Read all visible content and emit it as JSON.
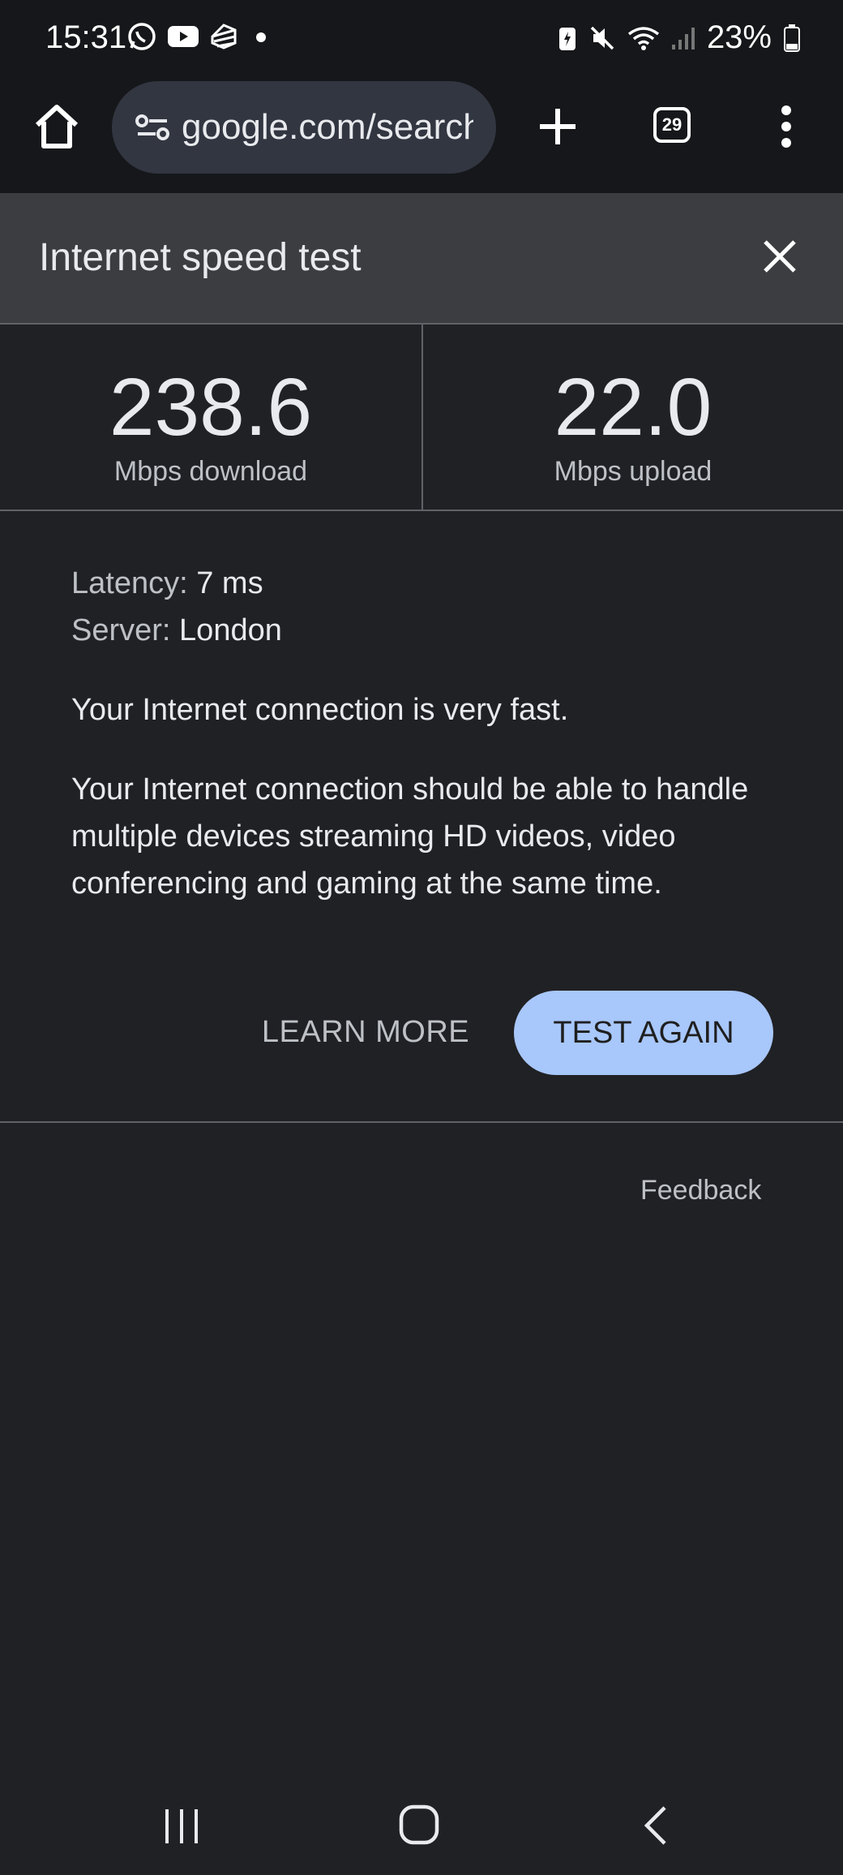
{
  "status_bar": {
    "time": "15:31",
    "left_icons": [
      "whatsapp-icon",
      "youtube-icon",
      "app-icon",
      "dot-icon"
    ],
    "right_icons": [
      "battery-saver-icon",
      "mute-icon",
      "wifi-icon",
      "signal-icon"
    ],
    "battery": "23%"
  },
  "toolbar": {
    "url": "google.com/search",
    "tab_count": "29"
  },
  "card": {
    "title": "Internet speed test"
  },
  "metrics": {
    "download_value": "238.6",
    "download_unit": "Mbps download",
    "upload_value": "22.0",
    "upload_unit": "Mbps upload"
  },
  "details": {
    "latency_label": "Latency:",
    "latency_value": "7 ms",
    "server_label": "Server:",
    "server_value": "London",
    "summary": "Your Internet connection is very fast.",
    "description": "Your Internet connection should be able to handle multiple devices streaming HD videos, video conferencing and gaming at the same time."
  },
  "actions": {
    "learn_more": "LEARN MORE",
    "test_again": "TEST AGAIN",
    "feedback": "Feedback"
  },
  "colors": {
    "background": "#202124",
    "header": "#3c3d40",
    "accent_button": "#a8c7fa"
  }
}
